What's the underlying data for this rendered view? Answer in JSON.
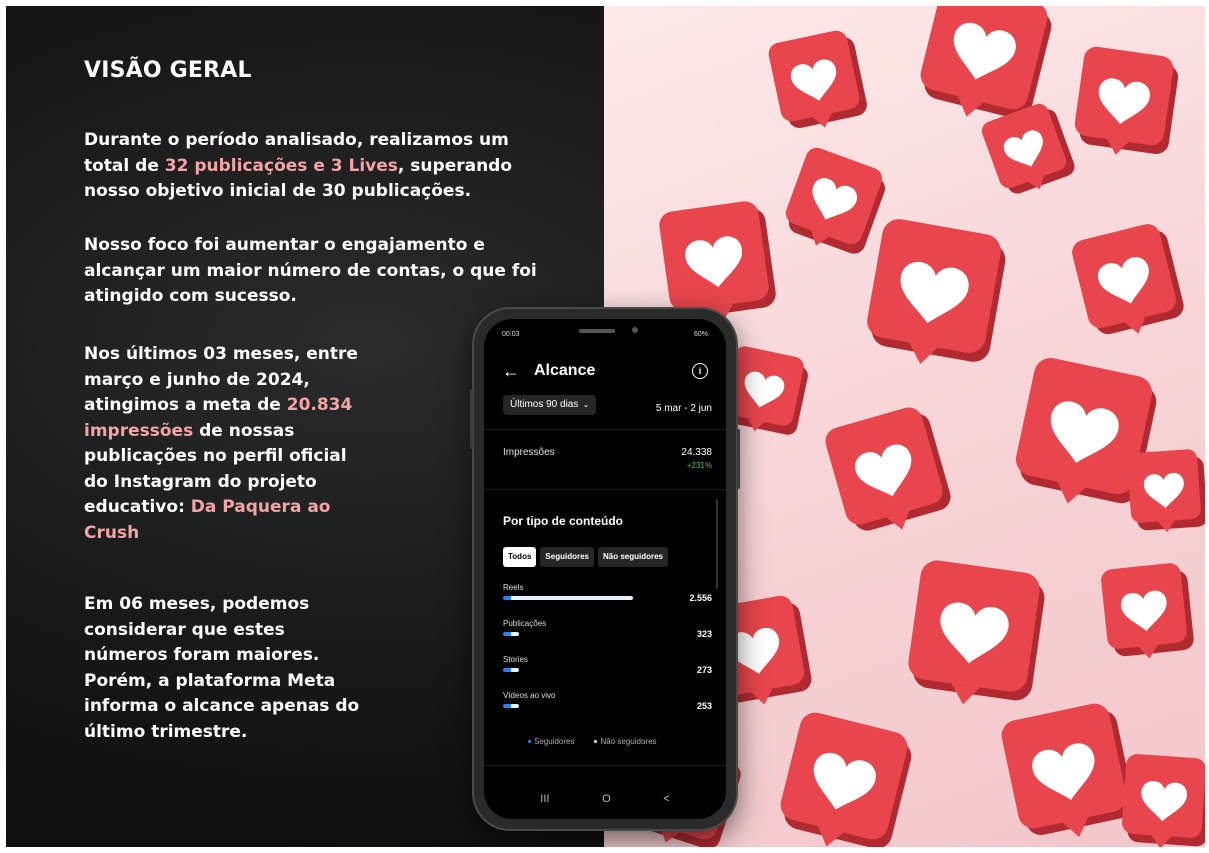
{
  "overview": {
    "title": "VISÃO GERAL",
    "p1_before": "Durante o período analisado, realizamos um total de ",
    "p1_highlight": "32 publicações e 3 Lives",
    "p1_after": ", superando nosso objetivo inicial de 30 publicações.",
    "p2": "Nosso foco foi aumentar o engajamento e alcançar um maior número de contas, o que foi atingido com sucesso.",
    "p3_before": "Nos últimos 03 meses, entre março e junho de 2024, atingimos a meta de ",
    "p3_highlight": "20.834 impressões",
    "p3_after": " de nossas publicações no perfil oficial do Instagram do projeto educativo: ",
    "p3_project": "Da Paquera ao Crush",
    "p4": "Em 06 meses, podemos considerar que estes números foram maiores. Porém, a plataforma Meta informa o alcance apenas do último trimestre."
  },
  "phone": {
    "status_time": "00:03",
    "status_battery": "60%",
    "header_title": "Alcance",
    "period_label": "Últimos 90 dias",
    "date_range": "5 mar - 2 jun",
    "impressions_label": "Impressões",
    "impressions_value": "24.338",
    "impressions_change": "+231%",
    "section_title": "Por tipo de conteúdo",
    "tabs": [
      "Todos",
      "Seguidores",
      "Não seguidores"
    ],
    "content_rows": [
      {
        "label": "Reels",
        "value": "2.556",
        "share": 1.0
      },
      {
        "label": "Publicações",
        "value": "323",
        "share": 0.126
      },
      {
        "label": "Stories",
        "value": "273",
        "share": 0.107
      },
      {
        "label": "Vídeos ao vivo",
        "value": "253",
        "share": 0.099
      }
    ],
    "legend": [
      "Seguidores",
      "Não seguidores"
    ],
    "nav": [
      "III",
      "O",
      "<"
    ]
  },
  "colors": {
    "highlight": "#f2a3a6",
    "followers_bar": "#2a7fff",
    "non_followers_bar": "#e8f0ff",
    "change_positive": "#3ec45a",
    "like_red": "#e8464c"
  },
  "icons": [
    "back-arrow-icon",
    "info-icon",
    "chevron-down-icon",
    "heart-like-icon"
  ]
}
